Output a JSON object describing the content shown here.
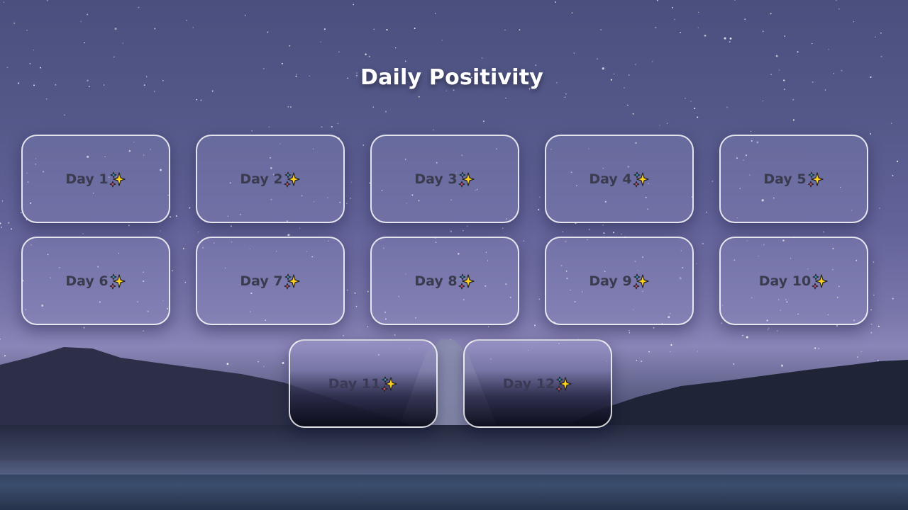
{
  "page": {
    "title": "Daily Positivity"
  },
  "cards": [
    {
      "label": "Day 1",
      "icon": "sparkles-icon"
    },
    {
      "label": "Day 2",
      "icon": "sparkles-icon"
    },
    {
      "label": "Day 3",
      "icon": "sparkles-icon"
    },
    {
      "label": "Day 4",
      "icon": "sparkles-icon"
    },
    {
      "label": "Day 5",
      "icon": "sparkles-icon"
    },
    {
      "label": "Day 6",
      "icon": "sparkles-icon"
    },
    {
      "label": "Day 7",
      "icon": "sparkles-icon"
    },
    {
      "label": "Day 8",
      "icon": "sparkles-icon"
    },
    {
      "label": "Day 9",
      "icon": "sparkles-icon"
    },
    {
      "label": "Day 10",
      "icon": "sparkles-icon"
    },
    {
      "label": "Day 11",
      "icon": "sparkles-icon"
    },
    {
      "label": "Day 12",
      "icon": "sparkles-icon"
    }
  ],
  "colors": {
    "card_border": "#ffffff",
    "card_text": "#3a3b4e",
    "title_text": "#ffffff",
    "sparkle_yellow": "#ffd21f",
    "sparkle_blue": "#38b6e6",
    "sparkle_pink": "#e85a8a"
  }
}
